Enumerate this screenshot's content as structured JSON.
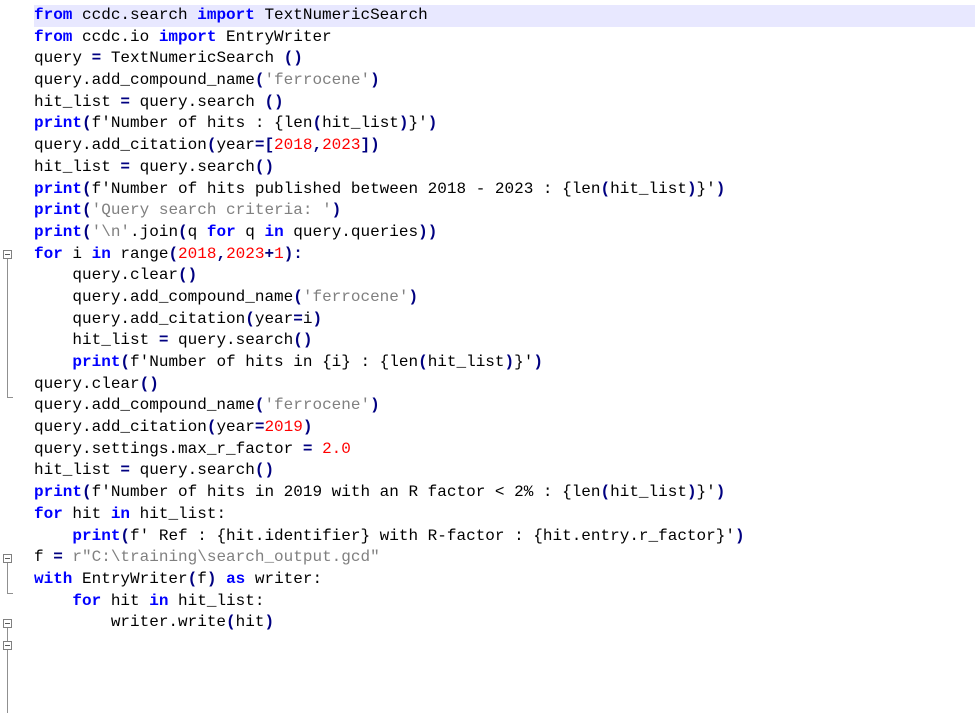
{
  "editor": {
    "language": "python",
    "colors": {
      "keyword": "#0000ff",
      "operator": "#000080",
      "string": "#808080",
      "number": "#ff0000",
      "identifier": "#000000",
      "current_line": "#e8e8ff",
      "fold_margin": "#808080"
    },
    "lines": [
      [
        {
          "t": "kw",
          "v": "from"
        },
        {
          "t": "id",
          "v": " ccdc.search "
        },
        {
          "t": "kw",
          "v": "import"
        },
        {
          "t": "id",
          "v": " TextNumericSearch"
        }
      ],
      [
        {
          "t": "kw",
          "v": "from"
        },
        {
          "t": "id",
          "v": " ccdc.io "
        },
        {
          "t": "kw",
          "v": "import"
        },
        {
          "t": "id",
          "v": " EntryWriter"
        }
      ],
      [
        {
          "t": "id",
          "v": "query "
        },
        {
          "t": "op",
          "v": "="
        },
        {
          "t": "id",
          "v": " TextNumericSearch "
        },
        {
          "t": "op",
          "v": "()"
        }
      ],
      [
        {
          "t": "id",
          "v": "query.add_compound_name"
        },
        {
          "t": "op",
          "v": "("
        },
        {
          "t": "str",
          "v": "'ferrocene'"
        },
        {
          "t": "op",
          "v": ")"
        }
      ],
      [
        {
          "t": "id",
          "v": "hit_list "
        },
        {
          "t": "op",
          "v": "="
        },
        {
          "t": "id",
          "v": " query.search "
        },
        {
          "t": "op",
          "v": "()"
        }
      ],
      [
        {
          "t": "kw",
          "v": "print"
        },
        {
          "t": "op",
          "v": "("
        },
        {
          "t": "id",
          "v": "f'Number of hits : {len"
        },
        {
          "t": "op",
          "v": "("
        },
        {
          "t": "id",
          "v": "hit_list"
        },
        {
          "t": "op",
          "v": ")"
        },
        {
          "t": "id",
          "v": "}'"
        },
        {
          "t": "op",
          "v": ")"
        }
      ],
      [
        {
          "t": "id",
          "v": "query.add_citation"
        },
        {
          "t": "op",
          "v": "("
        },
        {
          "t": "id",
          "v": "year"
        },
        {
          "t": "op",
          "v": "=["
        },
        {
          "t": "num",
          "v": "2018"
        },
        {
          "t": "op",
          "v": ","
        },
        {
          "t": "num",
          "v": "2023"
        },
        {
          "t": "op",
          "v": "])"
        }
      ],
      [
        {
          "t": "id",
          "v": "hit_list "
        },
        {
          "t": "op",
          "v": "="
        },
        {
          "t": "id",
          "v": " query.search"
        },
        {
          "t": "op",
          "v": "()"
        }
      ],
      [
        {
          "t": "kw",
          "v": "print"
        },
        {
          "t": "op",
          "v": "("
        },
        {
          "t": "id",
          "v": "f'Number of hits published between 2018 - 2023 : {len"
        },
        {
          "t": "op",
          "v": "("
        },
        {
          "t": "id",
          "v": "hit_list"
        },
        {
          "t": "op",
          "v": ")"
        },
        {
          "t": "id",
          "v": "}'"
        },
        {
          "t": "op",
          "v": ")"
        }
      ],
      [
        {
          "t": "kw",
          "v": "print"
        },
        {
          "t": "op",
          "v": "("
        },
        {
          "t": "str",
          "v": "'Query search criteria: '"
        },
        {
          "t": "op",
          "v": ")"
        }
      ],
      [
        {
          "t": "kw",
          "v": "print"
        },
        {
          "t": "op",
          "v": "("
        },
        {
          "t": "str",
          "v": "'\\n'"
        },
        {
          "t": "id",
          "v": ".join"
        },
        {
          "t": "op",
          "v": "("
        },
        {
          "t": "id",
          "v": "q "
        },
        {
          "t": "kw",
          "v": "for"
        },
        {
          "t": "id",
          "v": " q "
        },
        {
          "t": "kw",
          "v": "in"
        },
        {
          "t": "id",
          "v": " query.queries"
        },
        {
          "t": "op",
          "v": "))"
        }
      ],
      [
        {
          "t": "kw",
          "v": "for"
        },
        {
          "t": "id",
          "v": " i "
        },
        {
          "t": "kw",
          "v": "in"
        },
        {
          "t": "id",
          "v": " range"
        },
        {
          "t": "op",
          "v": "("
        },
        {
          "t": "num",
          "v": "2018"
        },
        {
          "t": "op",
          "v": ","
        },
        {
          "t": "num",
          "v": "2023"
        },
        {
          "t": "op",
          "v": "+"
        },
        {
          "t": "num",
          "v": "1"
        },
        {
          "t": "op",
          "v": "):"
        }
      ],
      [
        {
          "t": "id",
          "v": "    query.clear"
        },
        {
          "t": "op",
          "v": "()"
        }
      ],
      [
        {
          "t": "id",
          "v": "    query.add_compound_name"
        },
        {
          "t": "op",
          "v": "("
        },
        {
          "t": "str",
          "v": "'ferrocene'"
        },
        {
          "t": "op",
          "v": ")"
        }
      ],
      [
        {
          "t": "id",
          "v": "    query.add_citation"
        },
        {
          "t": "op",
          "v": "("
        },
        {
          "t": "id",
          "v": "year"
        },
        {
          "t": "op",
          "v": "="
        },
        {
          "t": "id",
          "v": "i"
        },
        {
          "t": "op",
          "v": ")"
        }
      ],
      [
        {
          "t": "id",
          "v": "    hit_list "
        },
        {
          "t": "op",
          "v": "="
        },
        {
          "t": "id",
          "v": " query.search"
        },
        {
          "t": "op",
          "v": "()"
        }
      ],
      [
        {
          "t": "id",
          "v": "    "
        },
        {
          "t": "kw",
          "v": "print"
        },
        {
          "t": "op",
          "v": "("
        },
        {
          "t": "id",
          "v": "f'Number of hits in {i} : {len"
        },
        {
          "t": "op",
          "v": "("
        },
        {
          "t": "id",
          "v": "hit_list"
        },
        {
          "t": "op",
          "v": ")"
        },
        {
          "t": "id",
          "v": "}'"
        },
        {
          "t": "op",
          "v": ")"
        }
      ],
      [
        {
          "t": "id",
          "v": "query.clear"
        },
        {
          "t": "op",
          "v": "()"
        }
      ],
      [
        {
          "t": "id",
          "v": "query.add_compound_name"
        },
        {
          "t": "op",
          "v": "("
        },
        {
          "t": "str",
          "v": "'ferrocene'"
        },
        {
          "t": "op",
          "v": ")"
        }
      ],
      [
        {
          "t": "id",
          "v": "query.add_citation"
        },
        {
          "t": "op",
          "v": "("
        },
        {
          "t": "id",
          "v": "year"
        },
        {
          "t": "op",
          "v": "="
        },
        {
          "t": "num",
          "v": "2019"
        },
        {
          "t": "op",
          "v": ")"
        }
      ],
      [
        {
          "t": "id",
          "v": "query.settings.max_r_factor "
        },
        {
          "t": "op",
          "v": "="
        },
        {
          "t": "id",
          "v": " "
        },
        {
          "t": "num",
          "v": "2.0"
        }
      ],
      [
        {
          "t": "id",
          "v": "hit_list "
        },
        {
          "t": "op",
          "v": "="
        },
        {
          "t": "id",
          "v": " query.search"
        },
        {
          "t": "op",
          "v": "()"
        }
      ],
      [
        {
          "t": "kw",
          "v": "print"
        },
        {
          "t": "op",
          "v": "("
        },
        {
          "t": "id",
          "v": "f'Number of hits in 2019 with an R factor < 2% : {len"
        },
        {
          "t": "op",
          "v": "("
        },
        {
          "t": "id",
          "v": "hit_list"
        },
        {
          "t": "op",
          "v": ")"
        },
        {
          "t": "id",
          "v": "}'"
        },
        {
          "t": "op",
          "v": ")"
        }
      ],
      [
        {
          "t": "kw",
          "v": "for"
        },
        {
          "t": "id",
          "v": " hit "
        },
        {
          "t": "kw",
          "v": "in"
        },
        {
          "t": "id",
          "v": " hit_list:"
        }
      ],
      [
        {
          "t": "id",
          "v": "    "
        },
        {
          "t": "kw",
          "v": "print"
        },
        {
          "t": "op",
          "v": "("
        },
        {
          "t": "id",
          "v": "f' Ref : {hit.identifier} with R-factor : {hit.entry.r_factor}'"
        },
        {
          "t": "op",
          "v": ")"
        }
      ],
      [
        {
          "t": "id",
          "v": "f "
        },
        {
          "t": "op",
          "v": "="
        },
        {
          "t": "id",
          "v": " "
        },
        {
          "t": "str",
          "v": "r\"C:\\training\\search_output.gcd\""
        }
      ],
      [
        {
          "t": "kw",
          "v": "with"
        },
        {
          "t": "id",
          "v": " EntryWriter"
        },
        {
          "t": "op",
          "v": "("
        },
        {
          "t": "id",
          "v": "f"
        },
        {
          "t": "op",
          "v": ")"
        },
        {
          "t": "id",
          "v": " "
        },
        {
          "t": "kw",
          "v": "as"
        },
        {
          "t": "id",
          "v": " writer:"
        }
      ],
      [
        {
          "t": "id",
          "v": "    "
        },
        {
          "t": "kw",
          "v": "for"
        },
        {
          "t": "id",
          "v": " hit "
        },
        {
          "t": "kw",
          "v": "in"
        },
        {
          "t": "id",
          "v": " hit_list:"
        }
      ],
      [
        {
          "t": "id",
          "v": "        writer.write"
        },
        {
          "t": "op",
          "v": "("
        },
        {
          "t": "id",
          "v": "hit"
        },
        {
          "t": "op",
          "v": ")"
        }
      ]
    ]
  }
}
